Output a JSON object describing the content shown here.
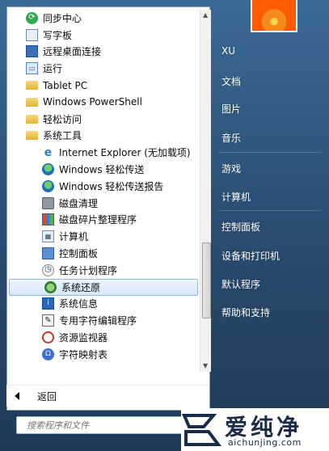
{
  "programs": [
    {
      "label": "同步中心",
      "icon": "sync-center-icon",
      "level": 0
    },
    {
      "label": "写字板",
      "icon": "wordpad-icon",
      "level": 0
    },
    {
      "label": "远程桌面连接",
      "icon": "remote-desktop-icon",
      "level": 0
    },
    {
      "label": "运行",
      "icon": "run-icon",
      "level": 0
    },
    {
      "label": "Tablet PC",
      "icon": "folder-icon",
      "level": 0
    },
    {
      "label": "Windows PowerShell",
      "icon": "folder-icon",
      "level": 0
    },
    {
      "label": "轻松访问",
      "icon": "folder-icon",
      "level": 0
    },
    {
      "label": "系统工具",
      "icon": "folder-icon",
      "level": 0
    },
    {
      "label": "Internet Explorer (无加载项)",
      "icon": "internet-explorer-icon",
      "level": 1
    },
    {
      "label": "Windows 轻松传送",
      "icon": "easy-transfer-icon",
      "level": 1
    },
    {
      "label": "Windows 轻松传送报告",
      "icon": "easy-transfer-report-icon",
      "level": 1
    },
    {
      "label": "磁盘清理",
      "icon": "disk-cleanup-icon",
      "level": 1
    },
    {
      "label": "磁盘碎片整理程序",
      "icon": "disk-defrag-icon",
      "level": 1
    },
    {
      "label": "计算机",
      "icon": "computer-icon",
      "level": 1
    },
    {
      "label": "控制面板",
      "icon": "control-panel-icon",
      "level": 1
    },
    {
      "label": "任务计划程序",
      "icon": "task-scheduler-icon",
      "level": 1
    },
    {
      "label": "系统还原",
      "icon": "system-restore-icon",
      "level": 1,
      "selected": true
    },
    {
      "label": "系统信息",
      "icon": "system-info-icon",
      "level": 1
    },
    {
      "label": "专用字符编辑程序",
      "icon": "char-editor-icon",
      "level": 1
    },
    {
      "label": "资源监视器",
      "icon": "resource-monitor-icon",
      "level": 1
    },
    {
      "label": "字符映射表",
      "icon": "character-map-icon",
      "level": 1
    }
  ],
  "back_label": "返回",
  "search": {
    "placeholder": "搜索程序和文件"
  },
  "right_menu": [
    {
      "label": "XU",
      "name": "user-name"
    },
    {
      "label": "文档",
      "name": "documents"
    },
    {
      "label": "图片",
      "name": "pictures"
    },
    {
      "label": "音乐",
      "name": "music"
    },
    {
      "label": "游戏",
      "name": "games"
    },
    {
      "label": "计算机",
      "name": "computer"
    },
    {
      "label": "控制面板",
      "name": "control-panel"
    },
    {
      "label": "设备和打印机",
      "name": "devices-printers"
    },
    {
      "label": "默认程序",
      "name": "default-programs"
    },
    {
      "label": "帮助和支持",
      "name": "help-support"
    }
  ],
  "watermark": {
    "cn": "爱纯净",
    "en": "aichunjing.com"
  },
  "colors": {
    "selection": "#d6e7fb",
    "right_pane": "#2f5a84"
  }
}
